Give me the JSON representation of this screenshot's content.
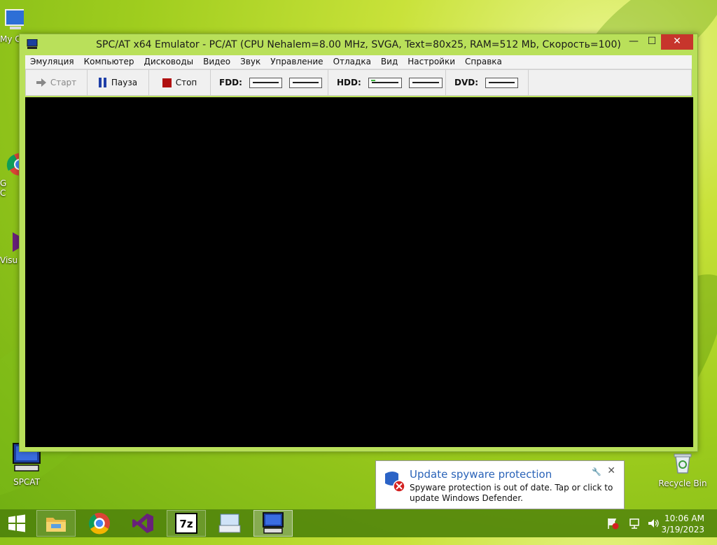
{
  "window": {
    "title": "SPC/AT x64 Emulator - PC/AT (CPU Nehalem=8.00 MHz, SVGA, Text=80x25, RAM=512 Mb, Скорость=100)",
    "minimize": "—",
    "maximize": "☐",
    "close": "✕"
  },
  "menu": [
    "Эмуляция",
    "Компьютер",
    "Дисководы",
    "Видео",
    "Звук",
    "Управление",
    "Отладка",
    "Вид",
    "Настройки",
    "Справка"
  ],
  "toolbar": {
    "start_label": "Старт",
    "pause_label": "Пауза",
    "stop_label": "Стоп",
    "fdd_label": "FDD:",
    "hdd_label": "HDD:",
    "dvd_label": "DVD:"
  },
  "desktop": {
    "icons": {
      "spcat": "SPCAT",
      "recycle": "Recycle Bin",
      "mycomputer_partial": "My C",
      "chrome_partial_1": "G",
      "chrome_partial_2": "C",
      "vs_partial": "Visu"
    }
  },
  "notification": {
    "title": "Update spyware protection",
    "body": "Spyware protection is out of date. Tap or click to update Windows Defender."
  },
  "taskbar": {
    "time": "10:06 AM",
    "date": "3/19/2023"
  },
  "colors": {
    "close_button": "#c7352c",
    "stop_square": "#b01010",
    "pause_bars": "#1f3fa8",
    "notification_title": "#2a63b8"
  }
}
